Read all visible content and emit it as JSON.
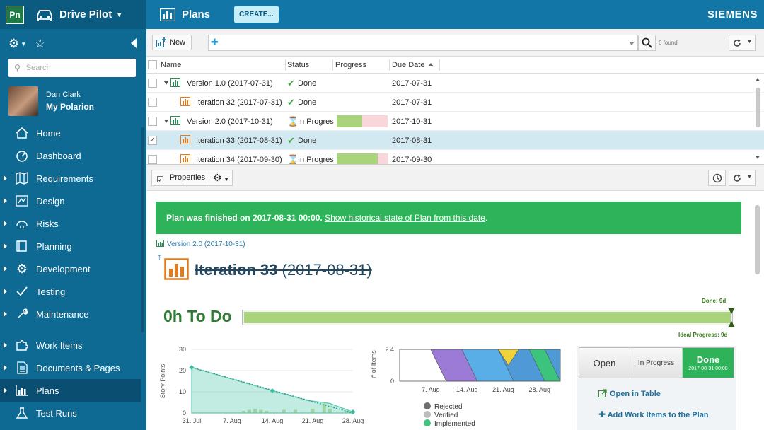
{
  "sidebar": {
    "logo": "Pn",
    "project": "Drive Pilot",
    "search_placeholder": "Search",
    "user": {
      "name": "Dan Clark",
      "subtitle": "My Polarion"
    },
    "items": [
      {
        "label": "Home",
        "icon": "home-icon"
      },
      {
        "label": "Dashboard",
        "icon": "dashboard-icon"
      },
      {
        "label": "Requirements",
        "icon": "requirements-icon"
      },
      {
        "label": "Design",
        "icon": "design-icon"
      },
      {
        "label": "Risks",
        "icon": "risks-icon"
      },
      {
        "label": "Planning",
        "icon": "planning-icon"
      },
      {
        "label": "Development",
        "icon": "development-icon"
      },
      {
        "label": "Testing",
        "icon": "testing-icon"
      },
      {
        "label": "Maintenance",
        "icon": "maintenance-icon"
      },
      {
        "label": "Work Items",
        "icon": "work-items-icon"
      },
      {
        "label": "Documents & Pages",
        "icon": "documents-icon"
      },
      {
        "label": "Plans",
        "icon": "plans-icon"
      },
      {
        "label": "Test Runs",
        "icon": "test-runs-icon"
      }
    ]
  },
  "header": {
    "title": "Plans",
    "create_label": "CREATE...",
    "brand": "SIEMENS"
  },
  "toolbar": {
    "new_label": "New",
    "found": "6 found"
  },
  "table": {
    "columns": {
      "name": "Name",
      "status": "Status",
      "progress": "Progress",
      "due": "Due Date"
    },
    "rows": [
      {
        "name": "Version 1.0 (2017-07-31)",
        "status": "Done",
        "due": "2017-07-31",
        "progress": null
      },
      {
        "name": "Iteration 32 (2017-07-31)",
        "status": "Done",
        "due": "2017-07-31",
        "progress": null
      },
      {
        "name": "Version 2.0 (2017-10-31)",
        "status": "In Progres",
        "due": "2017-10-31",
        "progress": 0.5
      },
      {
        "name": "Iteration 33 (2017-08-31)",
        "status": "Done",
        "due": "2017-08-31",
        "progress": null
      },
      {
        "name": "Iteration 34 (2017-09-30)",
        "status": "In Progres",
        "due": "2017-09-30",
        "progress": 0.8
      }
    ]
  },
  "properties": {
    "label": "Properties"
  },
  "plan": {
    "banner_bold": "Plan was finished on 2017-08-31 00:00.",
    "banner_link": "Show historical state of Plan from this date",
    "banner_end": ".",
    "parent": "Version 2.0 (2017-10-31)",
    "title_name": "Iteration 33",
    "title_date": "(2017-08-31)",
    "done_label": "Done: 9d",
    "todo": "0h To Do",
    "ideal_label": "Ideal Progress: 9d",
    "progress_fraction": 1.0
  },
  "states": {
    "open": "Open",
    "in_progress": "In Progress",
    "done": "Done",
    "done_ts": "2017-08-31 00:00"
  },
  "actions": {
    "open_table": "Open in Table",
    "add_items": "Add Work Items to the Plan"
  },
  "colors": {
    "accent": "#1277a6",
    "sidebar": "#0e6a93",
    "done_green": "#2fb35a",
    "progress_green": "#a9d47c"
  },
  "chart_data": [
    {
      "type": "area",
      "ylabel": "Story Points",
      "xlabel": "",
      "ylim": [
        0,
        30
      ],
      "yticks": [
        0,
        10,
        20,
        30
      ],
      "x_tick_labels": [
        "31. Jul",
        "7. Aug",
        "14. Aug",
        "21. Aug",
        "28. Aug"
      ],
      "x_range": [
        0,
        28
      ],
      "series": [
        {
          "kind": "area",
          "points": [
            [
              0,
              21.5
            ],
            [
              14,
              10.5
            ],
            [
              20,
              6
            ],
            [
              24,
              4.5
            ],
            [
              28,
              0.5
            ]
          ]
        },
        {
          "kind": "ideal-dotted",
          "points": [
            [
              0,
              21.5
            ],
            [
              28,
              0
            ]
          ]
        },
        {
          "kind": "bar",
          "points": [
            [
              9,
              1
            ],
            [
              10,
              1.5
            ],
            [
              11,
              2
            ],
            [
              12,
              1.5
            ],
            [
              13,
              1
            ],
            [
              16,
              1.5
            ],
            [
              18,
              1.5
            ],
            [
              21,
              2
            ],
            [
              23,
              4.5
            ],
            [
              24,
              2
            ],
            [
              27,
              1
            ],
            [
              28,
              0.5
            ]
          ]
        }
      ],
      "grid": true
    },
    {
      "type": "area",
      "ylabel": "# of Items",
      "ylim": [
        0,
        2.4
      ],
      "yticks": [
        0,
        2.4
      ],
      "x_tick_labels": [
        "7. Aug",
        "14. Aug",
        "21. Aug",
        "28. Aug"
      ],
      "x_range": [
        0,
        31
      ],
      "legend": [
        "Rejected",
        "Verified",
        "Implemented"
      ],
      "legend_colors": [
        "#707070",
        "#bdbdbd",
        "#3cc47c"
      ],
      "bands": [
        {
          "color": "#4f9ad6",
          "points": [
            [
              0,
              2.4
            ],
            [
              6,
              2.4
            ],
            [
              9,
              0
            ],
            [
              31,
              0
            ],
            [
              31,
              2.4
            ]
          ]
        },
        {
          "color": "#9b7bd6",
          "points": [
            [
              6,
              2.4
            ],
            [
              12,
              2.4
            ],
            [
              15,
              0
            ],
            [
              9,
              0
            ]
          ]
        },
        {
          "color": "#5aaee8",
          "points": [
            [
              12,
              2.4
            ],
            [
              19,
              2.4
            ],
            [
              22,
              0
            ],
            [
              15,
              0
            ]
          ]
        },
        {
          "color": "#f0d23a",
          "points": [
            [
              19,
              2.4
            ],
            [
              23,
              2.4
            ],
            [
              21,
              1.2
            ]
          ]
        },
        {
          "color": "#3cc47c",
          "points": [
            [
              25,
              2.4
            ],
            [
              28,
              2.4
            ],
            [
              31,
              0
            ],
            [
              28,
              0
            ]
          ]
        }
      ]
    }
  ]
}
